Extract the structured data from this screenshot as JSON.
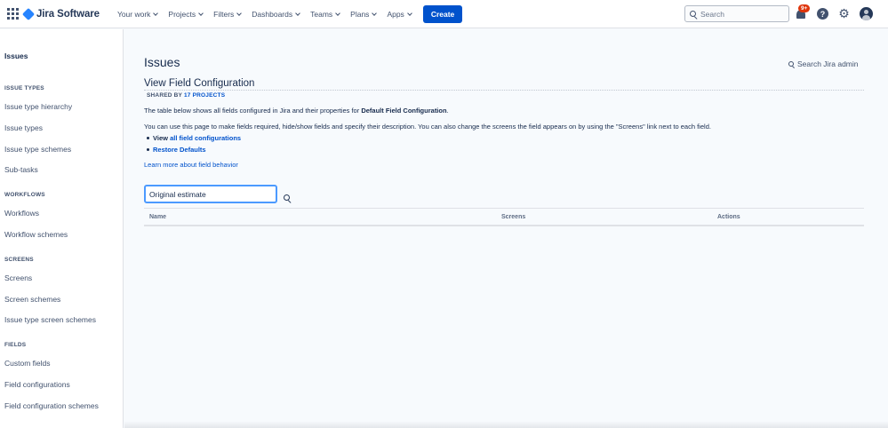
{
  "topnav": {
    "product": "Jira Software",
    "menus": [
      "Your work",
      "Projects",
      "Filters",
      "Dashboards",
      "Teams",
      "Plans",
      "Apps"
    ],
    "create_label": "Create",
    "search_placeholder": "Search",
    "notification_count": "9+",
    "help_label": "?"
  },
  "sidebar": {
    "title": "Issues",
    "sections": [
      {
        "heading": "ISSUE TYPES",
        "items": [
          "Issue type hierarchy",
          "Issue types",
          "Issue type schemes",
          "Sub-tasks"
        ]
      },
      {
        "heading": "WORKFLOWS",
        "items": [
          "Workflows",
          "Workflow schemes"
        ]
      },
      {
        "heading": "SCREENS",
        "items": [
          "Screens",
          "Screen schemes",
          "Issue type screen schemes"
        ]
      },
      {
        "heading": "FIELDS",
        "items": [
          "Custom fields",
          "Field configurations",
          "Field configuration schemes"
        ]
      }
    ]
  },
  "main": {
    "page_title": "Issues",
    "admin_search": "Search Jira admin",
    "section_title": "View Field Configuration",
    "shared_prefix": "SHARED BY",
    "shared_link": "17 PROJECTS",
    "desc1_prefix": "The table below shows all fields configured in Jira and their properties for",
    "desc1_bold": "Default Field Configuration",
    "desc1_suffix": ".",
    "desc2": "You can use this page to make fields required, hide/show fields and specify their description. You can also change the screens the field appears on by using the \"Screens\" link next to each field.",
    "bullet1_prefix": "View",
    "bullet1_link": "all field configurations",
    "bullet2_link": "Restore Defaults",
    "learn_more": "Learn more about field behavior",
    "filter_value": "Original estimate",
    "table_headers": [
      "Name",
      "Screens",
      "Actions"
    ]
  },
  "colors": {
    "brand": "#0052cc",
    "nav_text": "#42526e",
    "badge": "#de350b",
    "focus_ring": "#4c9aff"
  }
}
